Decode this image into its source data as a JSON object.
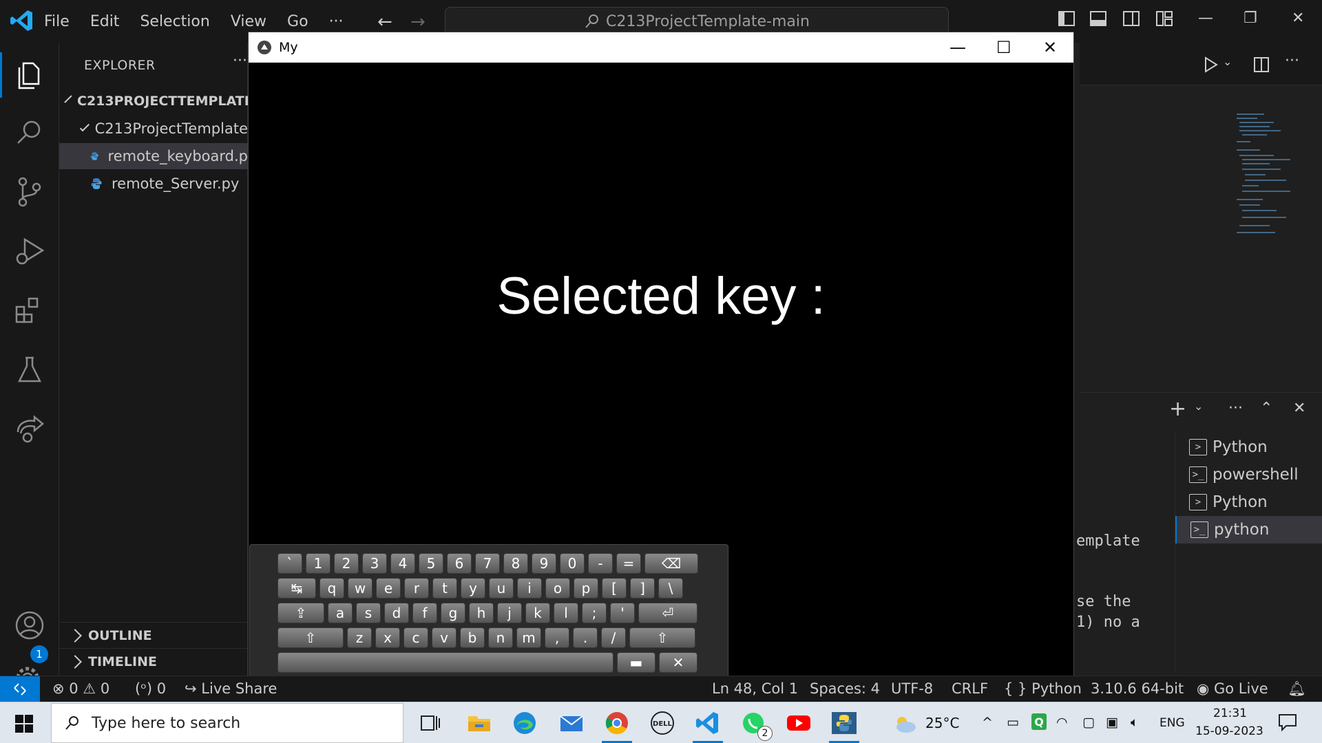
{
  "menu": {
    "items": [
      "File",
      "Edit",
      "Selection",
      "View",
      "Go"
    ],
    "more": "···"
  },
  "command_center": {
    "text": "C213ProjectTemplate-main"
  },
  "explorer": {
    "title": "EXPLORER",
    "more": "···",
    "root": "C213PROJECTTEMPLATE-",
    "folder": "C213ProjectTemplate",
    "files": [
      "remote_keyboard.p",
      "remote_Server.py"
    ],
    "outline": "OUTLINE",
    "timeline": "TIMELINE"
  },
  "settings_badge": "1",
  "terminal": {
    "items": [
      "Python",
      "powershell",
      "Python",
      "python"
    ],
    "lines": [
      "emplate",
      "se the",
      "1) no a"
    ]
  },
  "app_window": {
    "title": "My",
    "label": "Selected key :"
  },
  "keyboard": {
    "rows": [
      [
        "`",
        "1",
        "2",
        "3",
        "4",
        "5",
        "6",
        "7",
        "8",
        "9",
        "0",
        "-",
        "=",
        "⌫"
      ],
      [
        "↹",
        "q",
        "w",
        "e",
        "r",
        "t",
        "y",
        "u",
        "i",
        "o",
        "p",
        "[",
        "]",
        "\\"
      ],
      [
        "⇪",
        "a",
        "s",
        "d",
        "f",
        "g",
        "h",
        "j",
        "k",
        "l",
        ";",
        "'",
        "⏎"
      ],
      [
        "⇧",
        "z",
        "x",
        "c",
        "v",
        "b",
        "n",
        "m",
        ",",
        ".",
        "/",
        "⇧"
      ],
      [
        " ",
        "▬",
        "✕"
      ]
    ]
  },
  "statusbar": {
    "errors": "0",
    "warnings": "0",
    "ports": "0",
    "live_share": "Live Share",
    "position": "Ln 48, Col 1",
    "spaces": "Spaces: 4",
    "encoding": "UTF-8",
    "eol": "CRLF",
    "language": "Python",
    "interpreter": "3.10.6 64-bit",
    "go_live": "Go Live"
  },
  "taskbar": {
    "search_placeholder": "Type here to search",
    "weather": "25°C",
    "language": "ENG",
    "time": "21:31",
    "date": "15-09-2023",
    "whatsapp_badge": "2"
  }
}
